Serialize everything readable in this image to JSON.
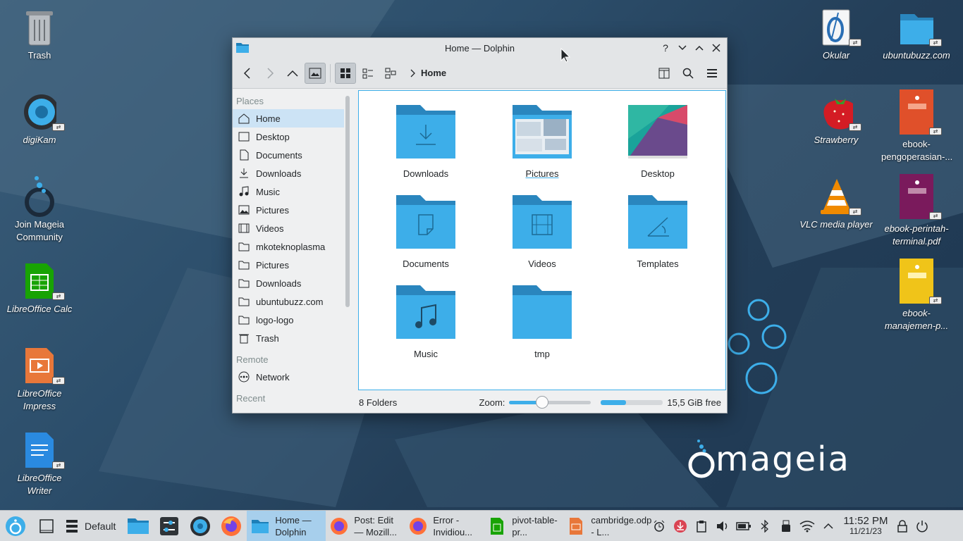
{
  "desktop": {
    "left_icons": [
      {
        "label": "Trash",
        "italic": false
      },
      {
        "label": "digiKam",
        "italic": true
      },
      {
        "label": "Join Mageia Community",
        "italic": false
      },
      {
        "label": "LibreOffice Calc",
        "italic": true
      },
      {
        "label": "LibreOffice Impress",
        "italic": true
      },
      {
        "label": "LibreOffice Writer",
        "italic": true
      }
    ],
    "right_icons": [
      {
        "label": "Okular"
      },
      {
        "label": "ubuntubuzz.com"
      },
      {
        "label": "Strawberry"
      },
      {
        "label": "ebook-pengoperasian-..."
      },
      {
        "label": "VLC media player"
      },
      {
        "label": "ebook-perintah-terminal.pdf"
      },
      {
        "label": "ebook-manajemen-p..."
      }
    ],
    "logo_text": "mageia"
  },
  "window": {
    "title": "Home — Dolphin",
    "breadcrumb": "Home",
    "places_header": "Places",
    "places": [
      {
        "label": "Home",
        "icon": "home-icon",
        "selected": true
      },
      {
        "label": "Desktop",
        "icon": "desktop-icon"
      },
      {
        "label": "Documents",
        "icon": "documents-icon"
      },
      {
        "label": "Downloads",
        "icon": "downloads-icon"
      },
      {
        "label": "Music",
        "icon": "music-icon"
      },
      {
        "label": "Pictures",
        "icon": "pictures-icon"
      },
      {
        "label": "Videos",
        "icon": "videos-icon"
      },
      {
        "label": "mkoteknoplasma",
        "icon": "folder-icon"
      },
      {
        "label": "Pictures",
        "icon": "folder-icon"
      },
      {
        "label": "Downloads",
        "icon": "folder-icon"
      },
      {
        "label": "ubuntubuzz.com",
        "icon": "folder-icon"
      },
      {
        "label": "logo-logo",
        "icon": "folder-icon"
      },
      {
        "label": "Trash",
        "icon": "trash-icon"
      }
    ],
    "remote_header": "Remote",
    "remote": [
      {
        "label": "Network",
        "icon": "network-icon"
      }
    ],
    "recent_header": "Recent",
    "items": [
      {
        "label": "Downloads",
        "emblem": "download"
      },
      {
        "label": "Pictures",
        "emblem": "pictures"
      },
      {
        "label": "Desktop",
        "emblem": "desktop"
      },
      {
        "label": "Documents",
        "emblem": "document"
      },
      {
        "label": "Videos",
        "emblem": "film"
      },
      {
        "label": "Templates",
        "emblem": "template"
      },
      {
        "label": "Music",
        "emblem": "music"
      },
      {
        "label": "tmp",
        "emblem": "none"
      }
    ],
    "status": {
      "count": "8 Folders",
      "zoom_label": "Zoom:",
      "zoom_level": 0.4,
      "free_space": "15,5 GiB free",
      "used_fraction": 0.4
    }
  },
  "taskbar": {
    "activity_label": "Default",
    "tasks": [
      {
        "label": "Home — Dolphin",
        "active": true,
        "color": "#3daee9"
      },
      {
        "label": "Post: Edit — Mozill...",
        "active": false,
        "color": "#e66000"
      },
      {
        "label": "Error - Invidiou...",
        "active": false,
        "color": "#e66000"
      },
      {
        "label": "pivot-table-pr...",
        "active": false,
        "color": "#18a303"
      },
      {
        "label": "cambridge.odp - L...",
        "active": false,
        "color": "#e8773a"
      }
    ],
    "clock_time": "11:52 PM",
    "clock_date": "11/21/23"
  }
}
